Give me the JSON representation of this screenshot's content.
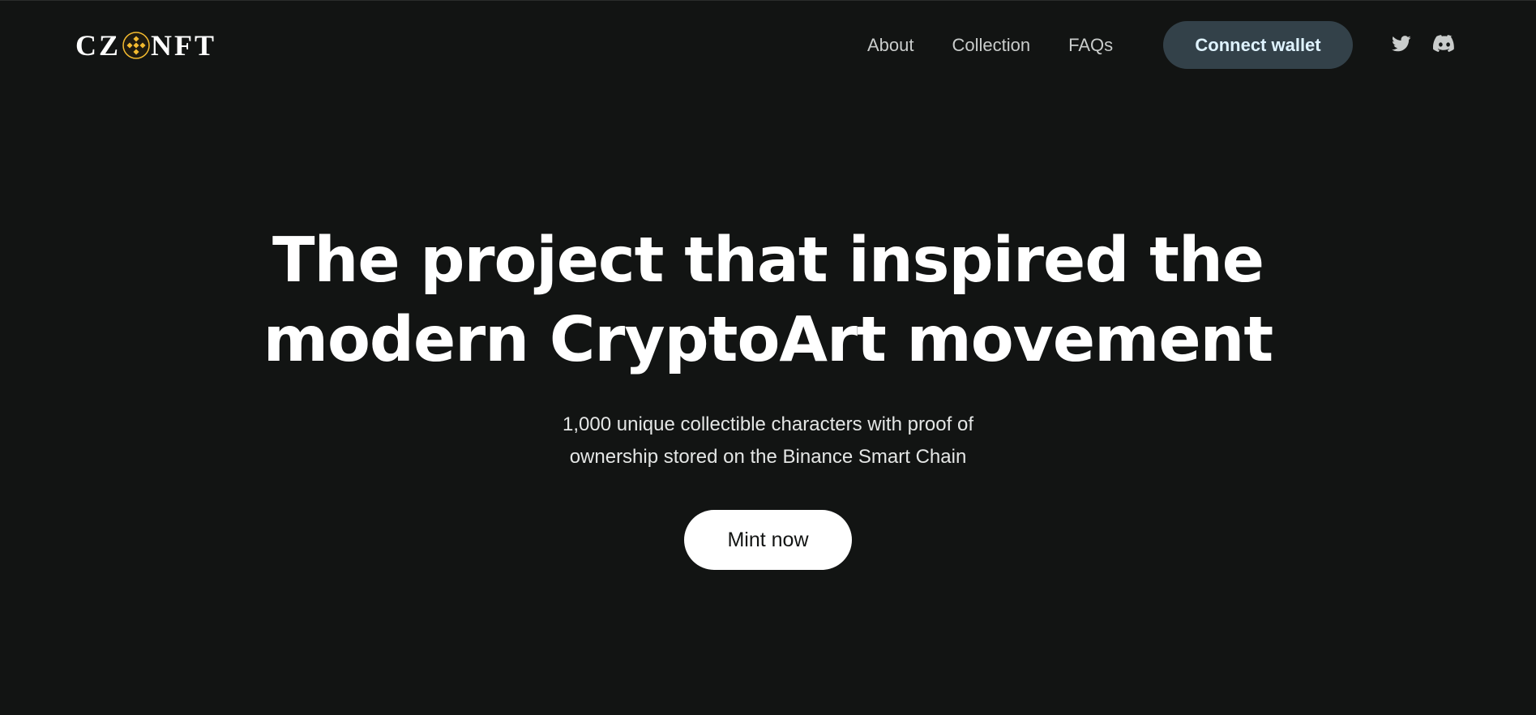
{
  "brand": {
    "logo_left": "CZ",
    "logo_right": "NFT",
    "coin_icon": "binance-coin-icon",
    "coin_color": "#f3ba2f"
  },
  "nav": {
    "links": [
      {
        "label": "About"
      },
      {
        "label": "Collection"
      },
      {
        "label": "FAQs"
      }
    ],
    "connect_label": "Connect wallet",
    "social": [
      {
        "icon": "twitter-icon"
      },
      {
        "icon": "discord-icon"
      }
    ]
  },
  "hero": {
    "title_line1": "The project that inspired the",
    "title_line2": "modern CryptoArt movement",
    "subtitle_line1": "1,000 unique collectible characters with proof of",
    "subtitle_line2": "ownership stored on the Binance Smart Chain",
    "cta_label": "Mint now"
  },
  "colors": {
    "background": "#121413",
    "connect_button": "#334149",
    "connect_text": "#dff3ff",
    "cta_button": "#ffffff"
  }
}
